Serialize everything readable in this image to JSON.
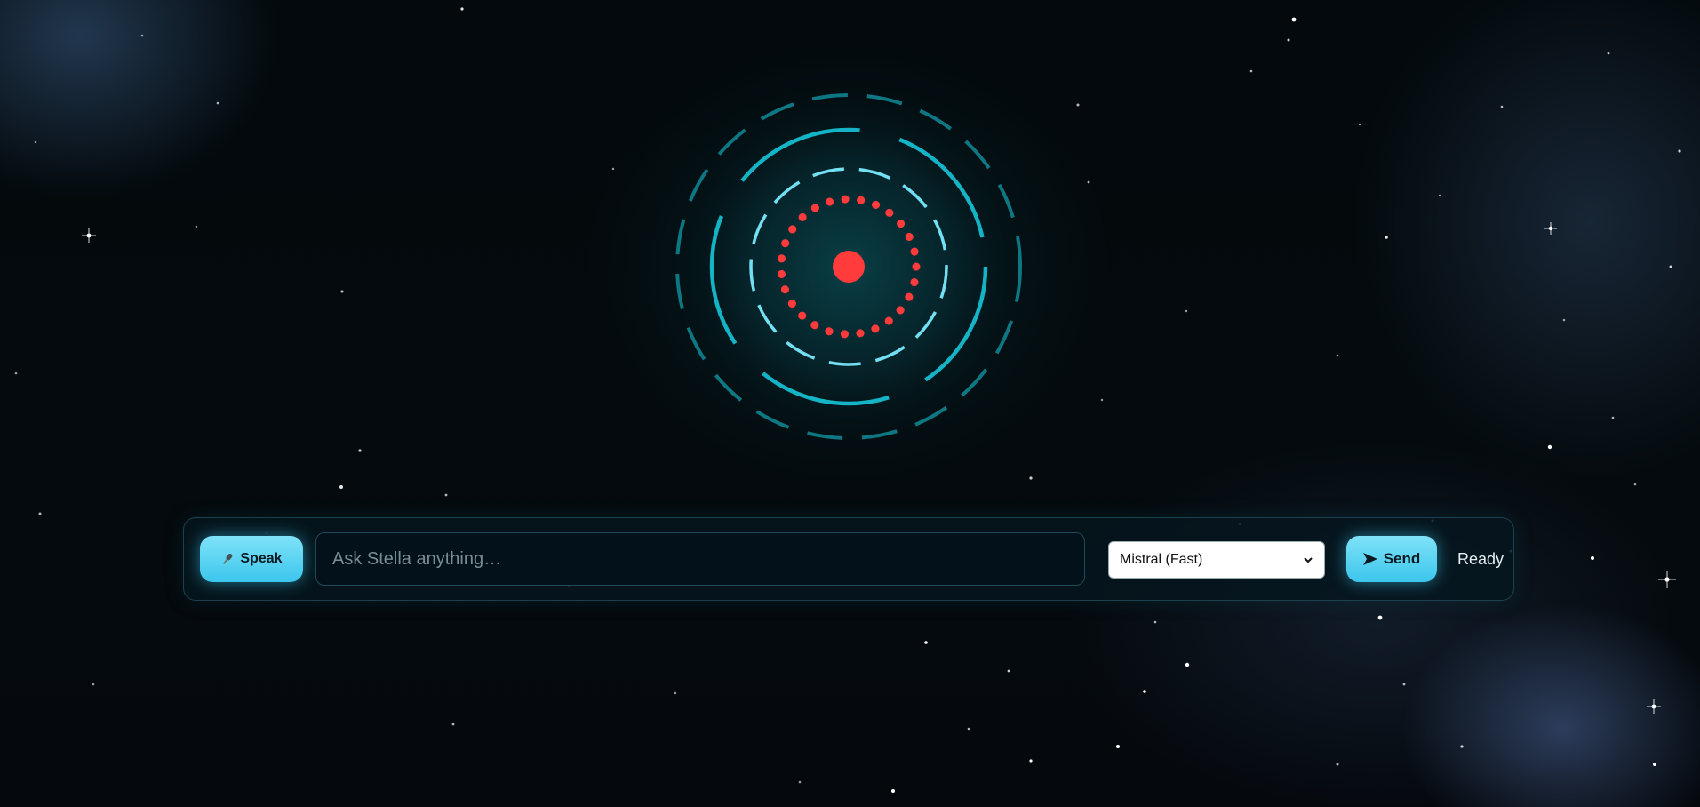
{
  "app": {
    "accent_color": "#4cd0f0",
    "core_color": "#ff3b3b",
    "ring_color": "#19b8c8"
  },
  "visualizer": {
    "state_icon": "assistant-orb-icon"
  },
  "command_bar": {
    "speak_label": "Speak",
    "speak_icon": "microphone-icon",
    "input_placeholder": "Ask Stella anything…",
    "input_value": "",
    "model_selected": "Mistral (Fast)",
    "send_label": "Send",
    "send_icon": "send-arrow-icon",
    "status_text": "Ready"
  }
}
